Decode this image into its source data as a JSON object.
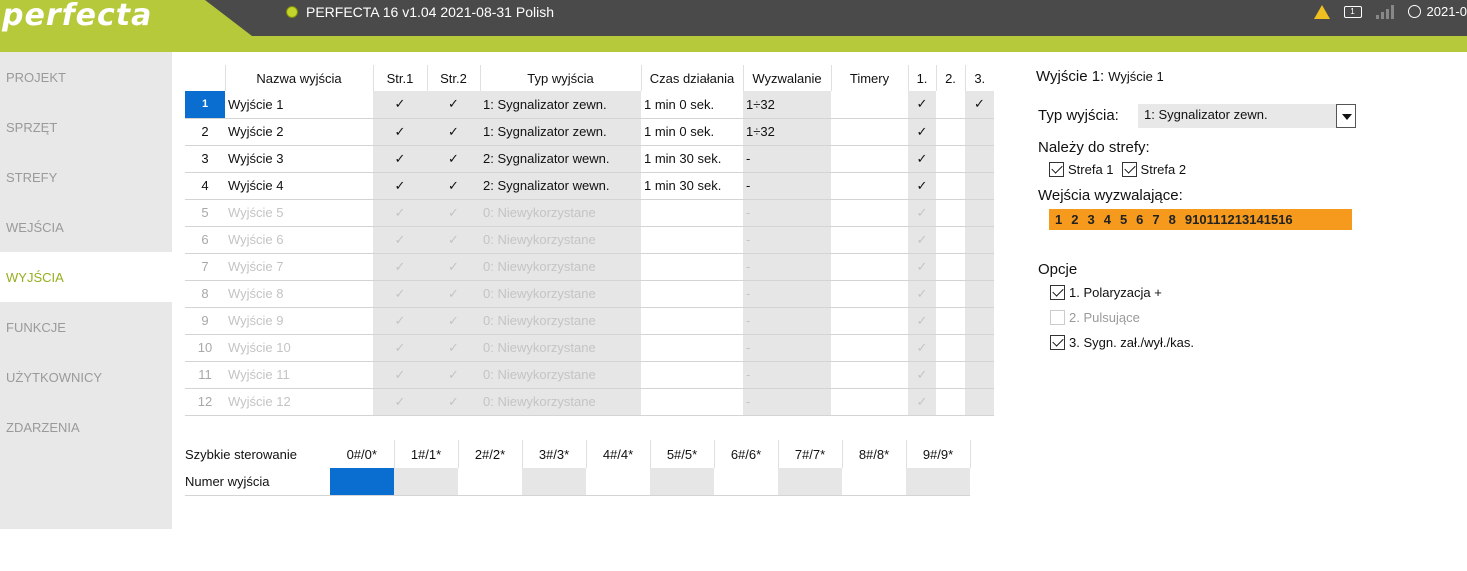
{
  "header": {
    "logo": "perfecta",
    "title": "PERFECTA 16 v1.04 2021-08-31 Polish",
    "battery_label": "1",
    "clock_text": "2021-0"
  },
  "sidebar": {
    "items": [
      {
        "label": "PROJEKT"
      },
      {
        "label": "SPRZĘT"
      },
      {
        "label": "STREFY"
      },
      {
        "label": "WEJŚCIA"
      },
      {
        "label": "WYJŚCIA"
      },
      {
        "label": "FUNKCJE"
      },
      {
        "label": "UŻYTKOWNICY"
      },
      {
        "label": "ZDARZENIA"
      }
    ],
    "active_index": 4
  },
  "table": {
    "headers": [
      "Nazwa wyjścia",
      "Str.1",
      "Str.2",
      "Typ wyjścia",
      "Czas działania",
      "Wyzwalanie",
      "Timery",
      "1.",
      "2.",
      "3."
    ],
    "rows": [
      {
        "num": "1",
        "name": "Wyjście  1",
        "s1": "✓",
        "s2": "✓",
        "type": "1: Sygnalizator zewn.",
        "time": "1 min 0 sek.",
        "trig": "1÷32",
        "tim": "",
        "t1": "✓",
        "t2": "",
        "t3": "✓"
      },
      {
        "num": "2",
        "name": "Wyjście  2",
        "s1": "✓",
        "s2": "✓",
        "type": "1: Sygnalizator zewn.",
        "time": "1 min 0 sek.",
        "trig": "1÷32",
        "tim": "",
        "t1": "✓",
        "t2": "",
        "t3": ""
      },
      {
        "num": "3",
        "name": "Wyjście  3",
        "s1": "✓",
        "s2": "✓",
        "type": "2: Sygnalizator wewn.",
        "time": "1 min 30 sek.",
        "trig": "-",
        "tim": "",
        "t1": "✓",
        "t2": "",
        "t3": ""
      },
      {
        "num": "4",
        "name": "Wyjście  4",
        "s1": "✓",
        "s2": "✓",
        "type": "2: Sygnalizator wewn.",
        "time": "1 min 30 sek.",
        "trig": "-",
        "tim": "",
        "t1": "✓",
        "t2": "",
        "t3": ""
      },
      {
        "num": "5",
        "name": "Wyjście  5",
        "s1": "✓",
        "s2": "✓",
        "type": "0: Niewykorzystane",
        "time": "",
        "trig": "-",
        "tim": "",
        "t1": "✓",
        "t2": "",
        "t3": ""
      },
      {
        "num": "6",
        "name": "Wyjście  6",
        "s1": "✓",
        "s2": "✓",
        "type": "0: Niewykorzystane",
        "time": "",
        "trig": "-",
        "tim": "",
        "t1": "✓",
        "t2": "",
        "t3": ""
      },
      {
        "num": "7",
        "name": "Wyjście  7",
        "s1": "✓",
        "s2": "✓",
        "type": "0: Niewykorzystane",
        "time": "",
        "trig": "-",
        "tim": "",
        "t1": "✓",
        "t2": "",
        "t3": ""
      },
      {
        "num": "8",
        "name": "Wyjście  8",
        "s1": "✓",
        "s2": "✓",
        "type": "0: Niewykorzystane",
        "time": "",
        "trig": "-",
        "tim": "",
        "t1": "✓",
        "t2": "",
        "t3": ""
      },
      {
        "num": "9",
        "name": "Wyjście  9",
        "s1": "✓",
        "s2": "✓",
        "type": "0: Niewykorzystane",
        "time": "",
        "trig": "-",
        "tim": "",
        "t1": "✓",
        "t2": "",
        "t3": ""
      },
      {
        "num": "10",
        "name": "Wyjście 10",
        "s1": "✓",
        "s2": "✓",
        "type": "0: Niewykorzystane",
        "time": "",
        "trig": "-",
        "tim": "",
        "t1": "✓",
        "t2": "",
        "t3": ""
      },
      {
        "num": "11",
        "name": "Wyjście 11",
        "s1": "✓",
        "s2": "✓",
        "type": "0: Niewykorzystane",
        "time": "",
        "trig": "-",
        "tim": "",
        "t1": "✓",
        "t2": "",
        "t3": ""
      },
      {
        "num": "12",
        "name": "Wyjście 12",
        "s1": "✓",
        "s2": "✓",
        "type": "0: Niewykorzystane",
        "time": "",
        "trig": "-",
        "tim": "",
        "t1": "✓",
        "t2": "",
        "t3": ""
      }
    ]
  },
  "quick": {
    "label": "Szybkie sterowanie",
    "row_label": "Numer wyjścia",
    "keys": [
      "0#/0*",
      "1#/1*",
      "2#/2*",
      "3#/3*",
      "4#/4*",
      "5#/5*",
      "6#/6*",
      "7#/7*",
      "8#/8*",
      "9#/9*"
    ]
  },
  "panel": {
    "title": "Wyjście 1:",
    "subtitle": "Wyjście  1",
    "type_label": "Typ wyjścia:",
    "type_value": "1: Sygnalizator zewn.",
    "zones_label": "Należy do strefy:",
    "zone1": "Strefa 1",
    "zone2": "Strefa 2",
    "inputs_label": "Wejścia wyzwalające:",
    "inputs": [
      "1",
      "2",
      "3",
      "4",
      "5",
      "6",
      "7",
      "8",
      "9",
      "10",
      "11",
      "12",
      "13",
      "14",
      "15",
      "16"
    ],
    "options_label": "Opcje",
    "opt1": "1. Polaryzacja +",
    "opt2": "2. Pulsujące",
    "opt3": "3. Sygn. zał./wył./kas."
  },
  "colors": {
    "brand": "#b6c93a",
    "selection": "#0a6ed1",
    "inputs_bg": "#f59a1d"
  }
}
